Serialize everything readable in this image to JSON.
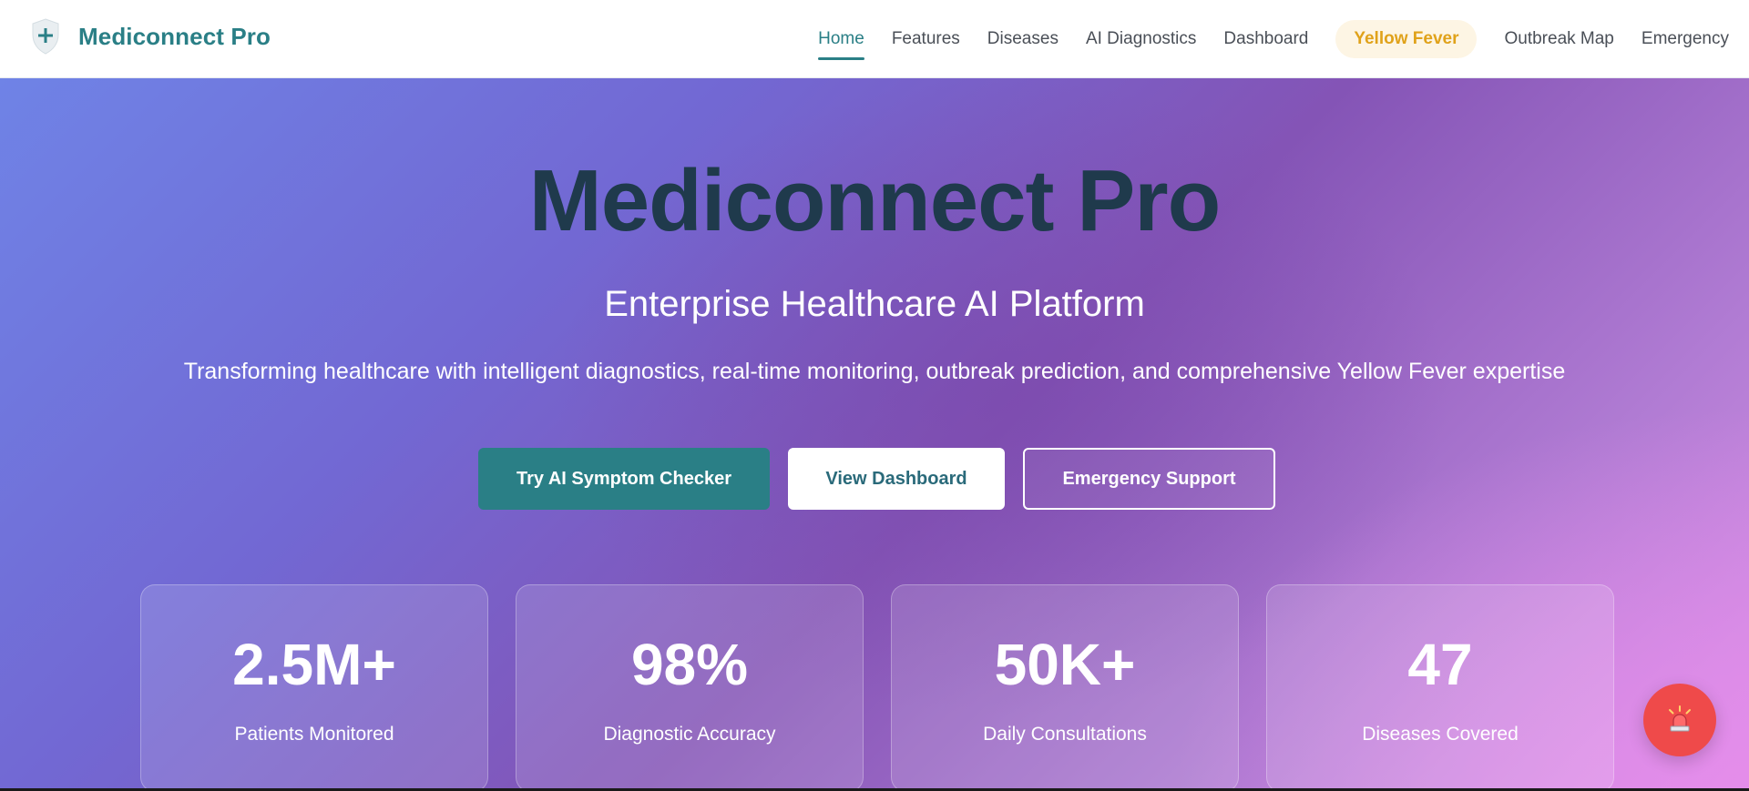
{
  "brand": {
    "name": "Mediconnect Pro",
    "icon": "shield-plus-icon"
  },
  "nav": {
    "items": [
      {
        "label": "Home",
        "state": "active"
      },
      {
        "label": "Features"
      },
      {
        "label": "Diseases"
      },
      {
        "label": "AI Diagnostics"
      },
      {
        "label": "Dashboard"
      },
      {
        "label": "Yellow Fever",
        "state": "highlighted"
      },
      {
        "label": "Outbreak Map"
      },
      {
        "label": "Emergency"
      }
    ]
  },
  "hero": {
    "title": "Mediconnect Pro",
    "subtitle": "Enterprise Healthcare AI Platform",
    "description": "Transforming healthcare with intelligent diagnostics, real-time monitoring, outbreak prediction, and comprehensive Yellow Fever expertise",
    "buttons": {
      "primary": "Try AI Symptom Checker",
      "secondary": "View Dashboard",
      "outline": "Emergency Support"
    }
  },
  "stats": [
    {
      "value": "2.5M+",
      "label": "Patients Monitored"
    },
    {
      "value": "98%",
      "label": "Diagnostic Accuracy"
    },
    {
      "value": "50K+",
      "label": "Daily Consultations"
    },
    {
      "value": "47",
      "label": "Diseases Covered"
    }
  ],
  "fab": {
    "icon": "emergency-siren-icon"
  },
  "colors": {
    "brand": "#2a7f86",
    "highlight": "#e0a21a",
    "title": "#1f3a4c",
    "emergency": "#ef4a4a"
  }
}
